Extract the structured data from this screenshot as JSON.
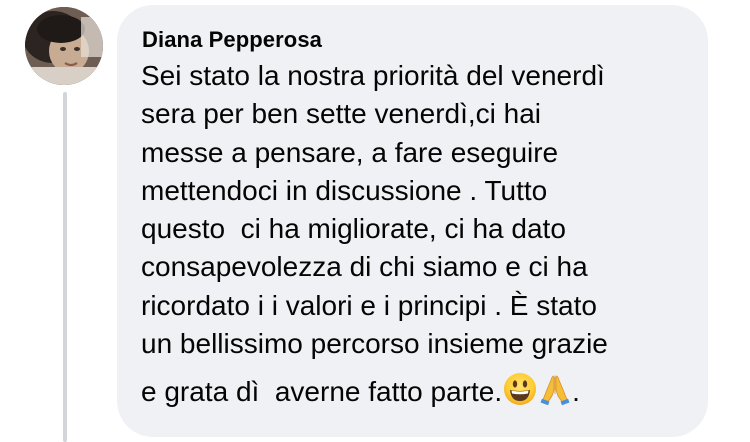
{
  "comment": {
    "author": "Diana Pepperosa",
    "lines": [
      "Sei stato la nostra priorità del venerdì",
      "sera per ben sette venerdì,ci hai",
      "messe a pensare, a fare eseguire",
      "mettendoci in discussione . Tutto",
      "questo  ci ha migliorate, ci ha dato",
      "consapevolezza di chi siamo e ci ha",
      "ricordato i i valori e i principi . È stato",
      "un bellissimo percorso insieme grazie"
    ],
    "last_line_text": "e grata dì  averne fatto parte.",
    "trailing_period": ".",
    "emojis": [
      "grinning-face-emoji",
      "folded-hands-emoji"
    ]
  },
  "colors": {
    "bubble": "#f0f1f4",
    "text": "#050505",
    "thread_line": "#d3d5d9"
  }
}
